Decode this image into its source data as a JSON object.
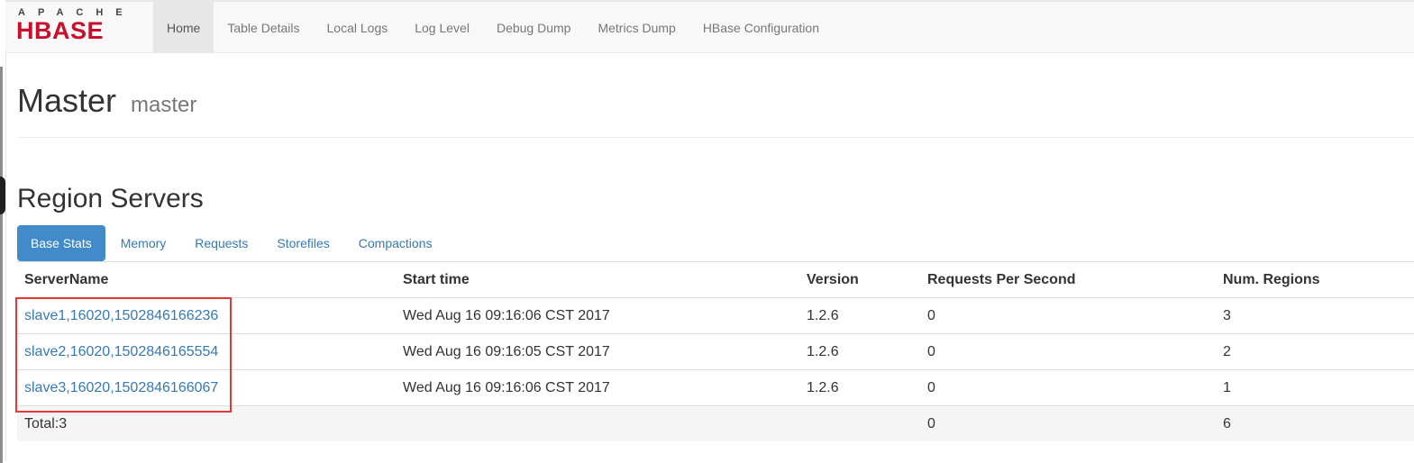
{
  "brand": {
    "apache": "APACHE",
    "hbase": "HBASE"
  },
  "nav": {
    "items": [
      {
        "label": "Home",
        "active": true
      },
      {
        "label": "Table Details"
      },
      {
        "label": "Local Logs"
      },
      {
        "label": "Log Level"
      },
      {
        "label": "Debug Dump"
      },
      {
        "label": "Metrics Dump"
      },
      {
        "label": "HBase Configuration"
      }
    ]
  },
  "header": {
    "title": "Master",
    "subtitle": "master"
  },
  "region_servers": {
    "title": "Region Servers",
    "tabs": [
      {
        "label": "Base Stats",
        "active": true
      },
      {
        "label": "Memory"
      },
      {
        "label": "Requests"
      },
      {
        "label": "Storefiles"
      },
      {
        "label": "Compactions"
      }
    ],
    "columns": [
      "ServerName",
      "Start time",
      "Version",
      "Requests Per Second",
      "Num. Regions"
    ],
    "rows": [
      {
        "server": "slave1,16020,1502846166236",
        "start": "Wed Aug 16 09:16:06 CST 2017",
        "version": "1.2.6",
        "rps": "0",
        "regions": "3"
      },
      {
        "server": "slave2,16020,1502846165554",
        "start": "Wed Aug 16 09:16:05 CST 2017",
        "version": "1.2.6",
        "rps": "0",
        "regions": "2"
      },
      {
        "server": "slave3,16020,1502846166067",
        "start": "Wed Aug 16 09:16:06 CST 2017",
        "version": "1.2.6",
        "rps": "0",
        "regions": "1"
      }
    ],
    "total": {
      "label": "Total:3",
      "rps": "0",
      "regions": "6"
    }
  },
  "colors": {
    "brand_red": "#c8102e",
    "link": "#337ab7",
    "active_tab": "#428bca",
    "highlight": "#e53935"
  }
}
